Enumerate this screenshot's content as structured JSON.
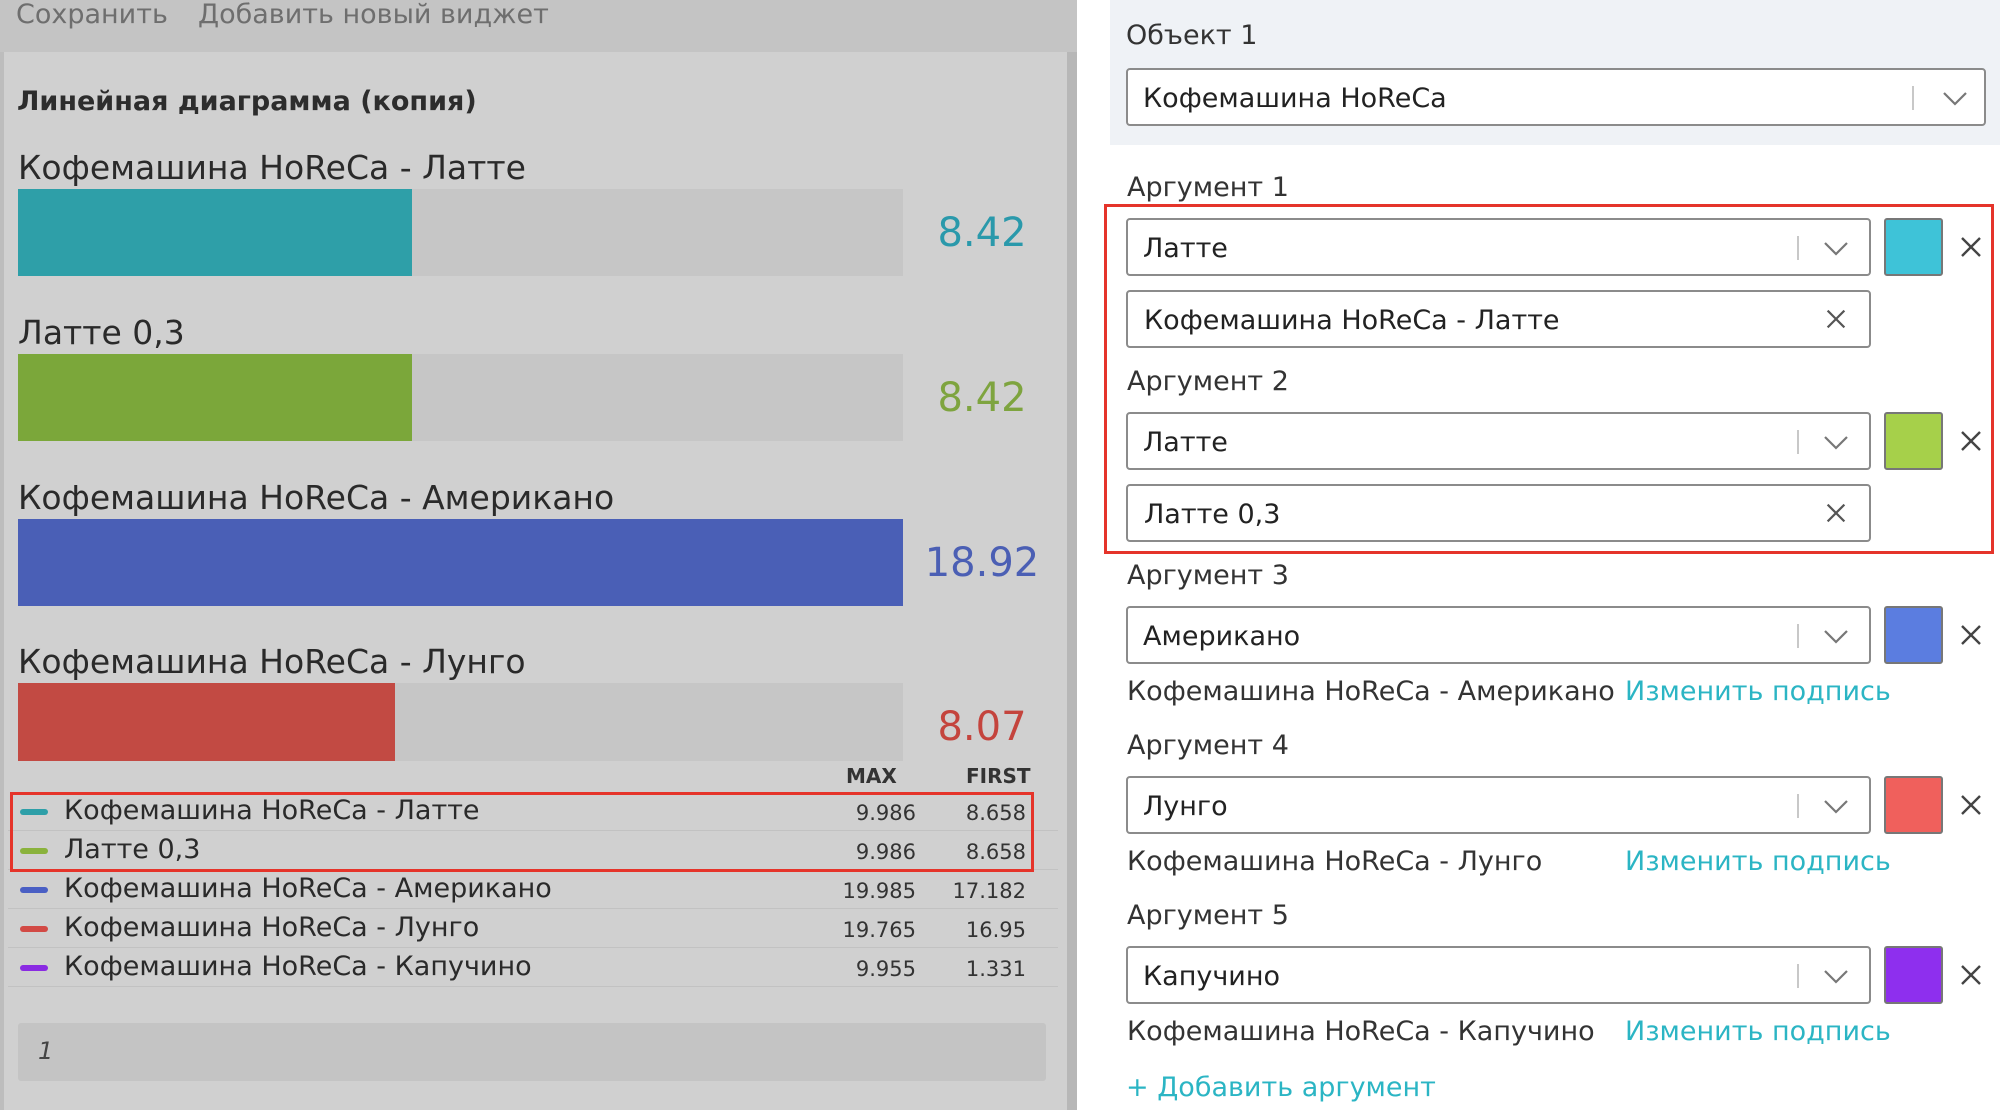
{
  "toolbar": {
    "save_label": "Сохранить",
    "add_widget_label": "Добавить новый виджет"
  },
  "widget": {
    "title": "Линейная диаграмма (копия)",
    "page_number": "1"
  },
  "chart_data": {
    "type": "bar",
    "orientation": "horizontal",
    "title": "Линейная диаграмма (копия)",
    "categories": [
      "Кофемашина HoReCa - Латте",
      "Латте 0,3",
      "Кофемашина HoReCa - Американо",
      "Кофемашина HoReCa - Лунго"
    ],
    "values": [
      8.42,
      8.42,
      18.92,
      8.07
    ],
    "value_labels": [
      "8.42",
      "8.42",
      "18.92",
      "8.07"
    ],
    "xlim": [
      0,
      18.92
    ],
    "colors": [
      "#2e9fa8",
      "#7ba73a",
      "#4a5fb6",
      "#c24a43"
    ],
    "value_colors": [
      "#2a99ab",
      "#7ea43f",
      "#4b5fb4",
      "#c4443d"
    ]
  },
  "legend": {
    "headers": {
      "max": "MAX",
      "first": "FIRST"
    },
    "rows": [
      {
        "name": "Кофемашина HoReCa - Латте",
        "max": "9.986",
        "first": "8.658",
        "color": "#2e9fa8"
      },
      {
        "name": "Латте 0,3",
        "max": "9.986",
        "first": "8.658",
        "color": "#8ab23c"
      },
      {
        "name": "Кофемашина HoReCa - Американо",
        "max": "19.985",
        "first": "17.182",
        "color": "#4a5fc4"
      },
      {
        "name": "Кофемашина HoReCa - Лунго",
        "max": "19.765",
        "first": "16.95",
        "color": "#d24a45"
      },
      {
        "name": "Кофемашина HoReCa - Капучино",
        "max": "9.955",
        "first": "1.331",
        "color": "#8a2be2"
      }
    ]
  },
  "settings": {
    "object_label": "Объект 1",
    "object_value": "Кофемашина HoReCa",
    "arguments": [
      {
        "label": "Аргумент 1",
        "value": "Латте",
        "color": "#3ec3d8",
        "caption": "Кофемашина HoReCa - Латте",
        "caption_editing": true
      },
      {
        "label": "Аргумент 2",
        "value": "Латте",
        "color": "#a6d04a",
        "caption": "Латте 0,3",
        "caption_editing": true
      },
      {
        "label": "Аргумент 3",
        "value": "Американо",
        "color": "#5b7de0",
        "caption": "Кофемашина HoReCa - Американо",
        "edit_caption_label": "Изменить подпись"
      },
      {
        "label": "Аргумент 4",
        "value": "Лунго",
        "color": "#f0605c",
        "caption": "Кофемашина HoReCa - Лунго",
        "edit_caption_label": "Изменить подпись"
      },
      {
        "label": "Аргумент 5",
        "value": "Капучино",
        "color": "#8e2fee",
        "caption": "Кофемашина HoReCa - Капучино",
        "edit_caption_label": "Изменить подпись"
      }
    ],
    "add_argument_label": "+ Добавить аргумент"
  },
  "icons": {
    "chevron": "chevron-down-icon",
    "remove": "close-icon",
    "clear": "clear-icon"
  }
}
